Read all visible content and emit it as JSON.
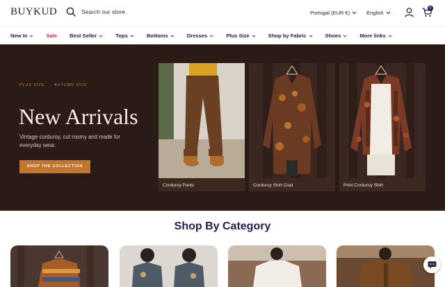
{
  "header": {
    "logo": "BUYKUD",
    "search_placeholder": "Search our store",
    "currency": "Portugal (EUR €)",
    "language": "English",
    "cart_count": "0"
  },
  "nav": {
    "items": [
      {
        "label": "New In",
        "dropdown": true
      },
      {
        "label": "Sale",
        "dropdown": false
      },
      {
        "label": "Best Seller",
        "dropdown": true
      },
      {
        "label": "Tops",
        "dropdown": true
      },
      {
        "label": "Bottoms",
        "dropdown": true
      },
      {
        "label": "Dresses",
        "dropdown": true
      },
      {
        "label": "Plus Size",
        "dropdown": true
      },
      {
        "label": "Shop by Fabric",
        "dropdown": true
      },
      {
        "label": "Shoes",
        "dropdown": true
      },
      {
        "label": "More links",
        "dropdown": true
      }
    ]
  },
  "hero": {
    "kicker_left": "PLUS SIZE",
    "kicker_right": "AUTUMN 2026",
    "title": "New Arrivals",
    "subtitle": "Vintage corduroy, cut roomy and made for everyday wear.",
    "cta_label": "SHOP THE COLLECTION",
    "cards": [
      {
        "label": "Corduroy Pants"
      },
      {
        "label": "Corduroy Shirt Coat"
      },
      {
        "label": "Print Corduroy Shirt"
      }
    ]
  },
  "category_section": {
    "title": "Shop By Category"
  },
  "colors": {
    "brand": "#2a1a4f",
    "sale": "#c4264b",
    "hero_bg": "#2b1b17",
    "cta": "#c4762f"
  }
}
